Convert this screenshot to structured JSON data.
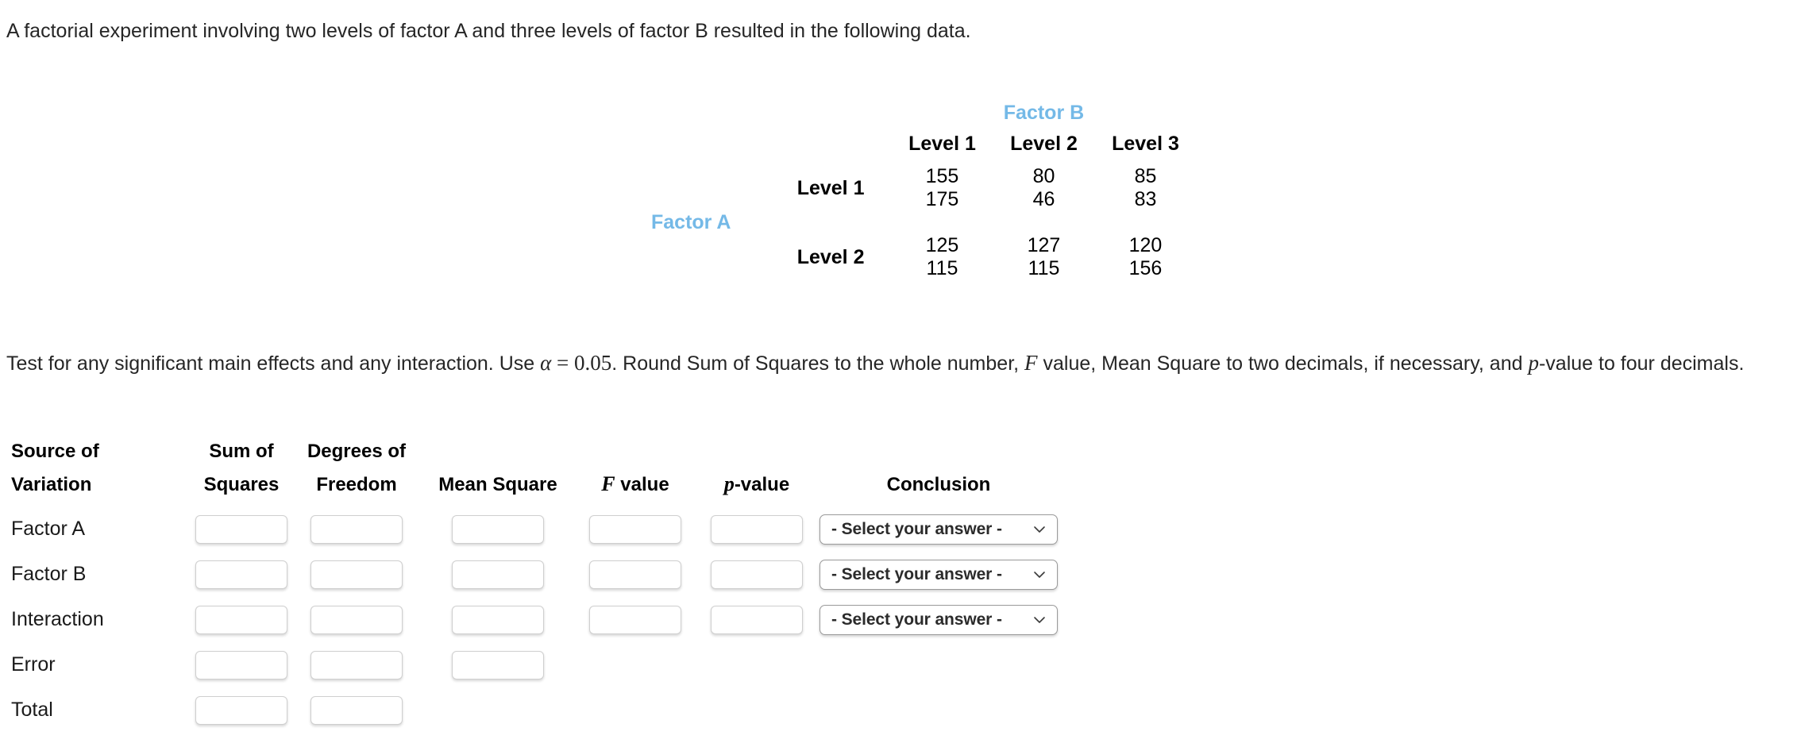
{
  "intro": "A factorial experiment involving two levels of factor A and three levels of factor B resulted in the following data.",
  "data_table": {
    "factor_b_label": "Factor B",
    "factor_a_label": "Factor A",
    "column_headers": [
      "Level 1",
      "Level 2",
      "Level 3"
    ],
    "rows": [
      {
        "label": "Level 1",
        "replicate1": [
          "155",
          "80",
          "85"
        ],
        "replicate2": [
          "175",
          "46",
          "83"
        ]
      },
      {
        "label": "Level 2",
        "replicate1": [
          "125",
          "127",
          "120"
        ],
        "replicate2": [
          "115",
          "115",
          "156"
        ]
      }
    ]
  },
  "instruction": {
    "part1": "Test for any significant main effects and any interaction. Use ",
    "alpha": "α",
    "equals": " = ",
    "alpha_value": "0.05",
    "part2": ". Round Sum of Squares to the whole number, ",
    "f_symbol": "F",
    "part3": " value, Mean Square to two decimals, if necessary, and ",
    "p_symbol": "p",
    "part4": "-value to four decimals."
  },
  "anova": {
    "headers": {
      "source_of_variation": "Source of\nVariation",
      "sum_of_squares": "Sum of\nSquares",
      "degrees_of_freedom": "Degrees of\nFreedom",
      "mean_square": "Mean Square",
      "f_value_symbol": "F",
      "f_value_text": " value",
      "p_value_symbol": "p",
      "p_value_text": "-value",
      "conclusion": "Conclusion"
    },
    "rows": [
      {
        "label": "Factor A",
        "sum_of_squares": "",
        "degrees_of_freedom": "",
        "mean_square": "",
        "f_value": "",
        "p_value": "",
        "conclusion": "- Select your answer -"
      },
      {
        "label": "Factor B",
        "sum_of_squares": "",
        "degrees_of_freedom": "",
        "mean_square": "",
        "f_value": "",
        "p_value": "",
        "conclusion": "- Select your answer -"
      },
      {
        "label": "Interaction",
        "sum_of_squares": "",
        "degrees_of_freedom": "",
        "mean_square": "",
        "f_value": "",
        "p_value": "",
        "conclusion": "- Select your answer -"
      },
      {
        "label": "Error",
        "sum_of_squares": "",
        "degrees_of_freedom": "",
        "mean_square": "",
        "f_value": null,
        "p_value": null,
        "conclusion": null
      },
      {
        "label": "Total",
        "sum_of_squares": "",
        "degrees_of_freedom": "",
        "mean_square": null,
        "f_value": null,
        "p_value": null,
        "conclusion": null
      }
    ]
  },
  "icons": {
    "chevron_down": "chevron-down-icon"
  },
  "colors": {
    "factor_label_blue": "#74b9e7",
    "body_text": "#262626",
    "input_border": "#cfcfcf",
    "select_border": "#9a9a9a"
  }
}
